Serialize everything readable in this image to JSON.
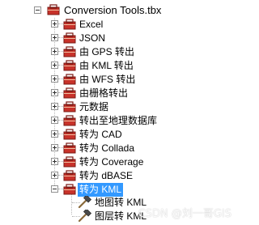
{
  "toolbox": {
    "name": "Conversion Tools.tbx",
    "toolsets": [
      {
        "label": "Excel"
      },
      {
        "label": "JSON"
      },
      {
        "label": "由 GPS 转出"
      },
      {
        "label": "由 KML 转出"
      },
      {
        "label": "由 WFS 转出"
      },
      {
        "label": "由栅格转出"
      },
      {
        "label": "元数据"
      },
      {
        "label": "转出至地理数据库"
      },
      {
        "label": "转为 CAD"
      },
      {
        "label": "转为 Collada"
      },
      {
        "label": "转为 Coverage"
      },
      {
        "label": "转为 dBASE"
      },
      {
        "label": "转为 KML"
      }
    ],
    "tools": [
      {
        "label": "地图转 KML"
      },
      {
        "label": "图层转 KML"
      }
    ]
  },
  "watermark": "CSDN @刘一哥GIS",
  "colors": {
    "selection": "#3399ff",
    "toolbox_red": "#c8322a"
  }
}
